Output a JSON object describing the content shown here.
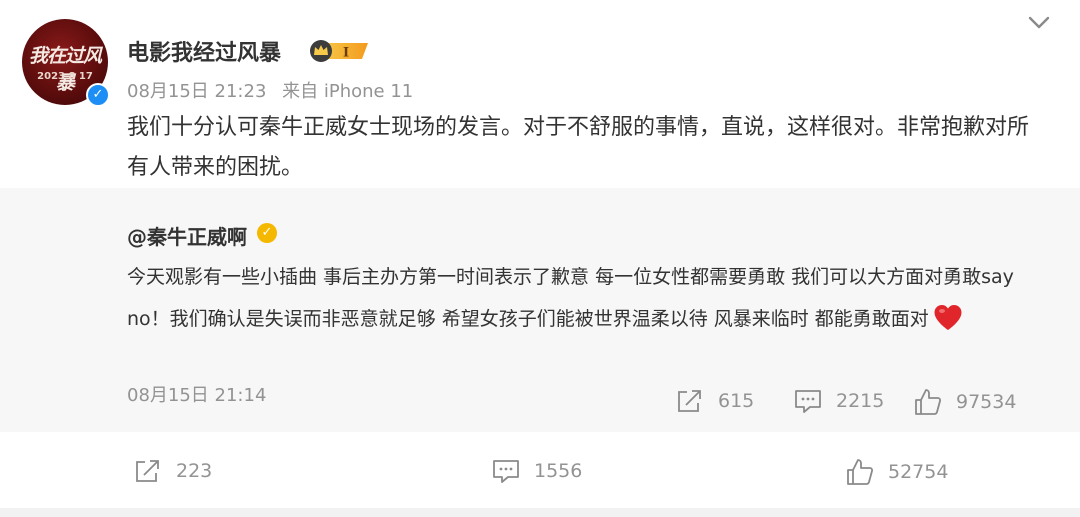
{
  "post": {
    "avatar": {
      "title": "我在过风暴",
      "date_text": "2023 8 17"
    },
    "username": "电影我经过风暴",
    "vip_level": "I",
    "date": "08月15日 21:23",
    "source": "来自 iPhone 11",
    "text": "我们十分认可秦牛正威女士现场的发言。对于不舒服的事情，直说，这样很对。非常抱歉对所有人带来的困扰。",
    "icons": {
      "more": "chevron-down-icon",
      "verified": "verified-badge-icon",
      "vip": "vip-crown-icon"
    }
  },
  "retweet": {
    "username": "@秦牛正威啊",
    "text": "今天观影有一些小插曲 事后主办方第一时间表示了歉意 每一位女性都需要勇敢 我们可以大方面对勇敢say no！我们确认是失误而非恶意就足够 希望女孩子们能被世界温柔以待 风暴来临时 都能勇敢面对",
    "emoji": "red-heart-icon",
    "date": "08月15日 21:14",
    "share_count": "615",
    "comment_count": "2215",
    "like_count": "97534"
  },
  "actions": {
    "share_count": "223",
    "comment_count": "1556",
    "like_count": "52754"
  },
  "colors": {
    "text": "#333333",
    "meta": "#939393",
    "retweet_bg": "#f7f7f7",
    "verified_blue": "#1d8ef5",
    "verified_gold": "#f5b800",
    "heart_red": "#e0262b"
  }
}
